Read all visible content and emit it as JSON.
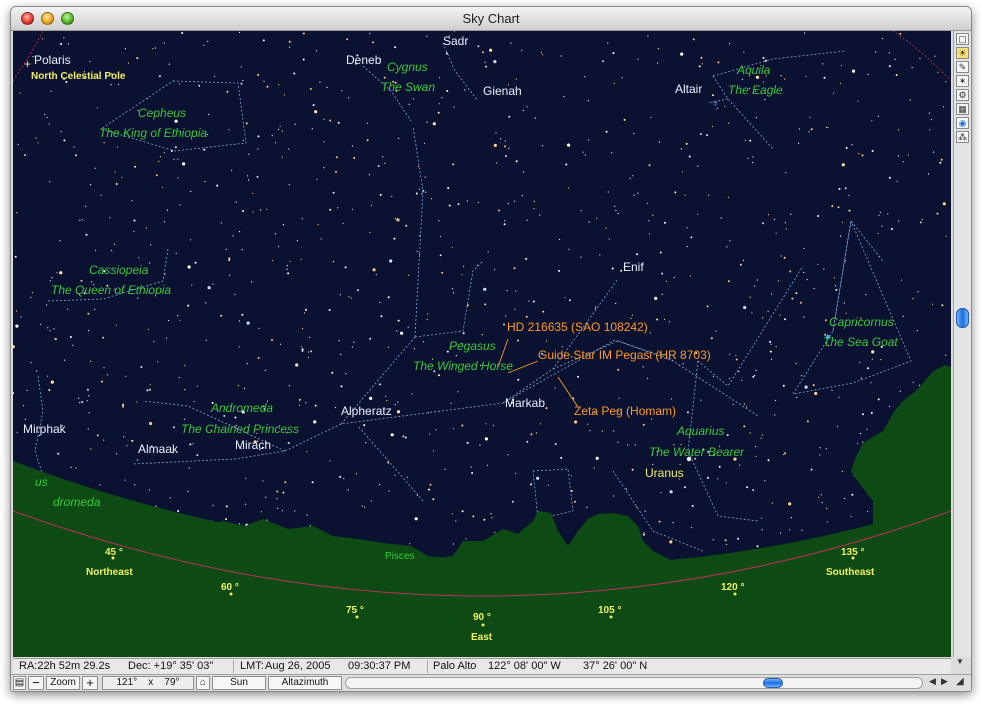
{
  "window": {
    "title": "Sky Chart"
  },
  "sky": {
    "star_labels": [
      {
        "text": "Polaris"
      },
      {
        "text": "North Celestial Pole"
      },
      {
        "text": "Deneb"
      },
      {
        "text": "Sadr"
      },
      {
        "text": "Gienah"
      },
      {
        "text": "Altair"
      },
      {
        "text": "Enif"
      },
      {
        "text": "Markab"
      },
      {
        "text": "Alpheratz"
      },
      {
        "text": "Mirphak"
      },
      {
        "text": "Almaak"
      },
      {
        "text": "Mirach"
      }
    ],
    "constellations": [
      {
        "name": "Cygnus",
        "desc": "The Swan"
      },
      {
        "name": "Cepheus",
        "desc": "The King of Ethiopia"
      },
      {
        "name": "Aquila",
        "desc": "The Eagle"
      },
      {
        "name": "Cassiopeia",
        "desc": "The Queen of Ethiopia"
      },
      {
        "name": "Capricornus",
        "desc": "The Sea Goat"
      },
      {
        "name": "Pegasus",
        "desc": "The Winged Horse"
      },
      {
        "name": "Andromeda",
        "desc": "The Chained Princess"
      },
      {
        "name": "Aquarius",
        "desc": "The Water Bearer"
      }
    ],
    "partial_labels": [
      "us",
      "dromeda",
      "Pisces"
    ],
    "target_labels": [
      "HD 216635  (SAO 108242)",
      "Guide Star IM Pegasi  (HR  8703)",
      "Zeta Peg  (Homam)"
    ],
    "planet": "Uranus",
    "horizon": {
      "directions": [
        "Northeast",
        "East",
        "Southeast"
      ],
      "degrees": [
        "45 °",
        "60 °",
        "75 °",
        "90 °",
        "105 °",
        "120 °",
        "135 °"
      ]
    }
  },
  "status": {
    "ra": "RA:22h 52m 29.2s",
    "dec": "Dec: +19° 35' 03\"",
    "lmt_label": "LMT:",
    "date": "Aug 26, 2005",
    "time": "09:30:37 PM",
    "place": "Palo Alto",
    "lon": "122° 08' 00\" W",
    "lat": "37° 26' 00\" N"
  },
  "toolbar": {
    "zoom_label": "Zoom",
    "zoom_out": "−",
    "zoom_in": "+",
    "fov_w": "121°",
    "fov_x": "x",
    "fov_h": "79°",
    "center_object": "Sun",
    "projection": "Altazimuth"
  },
  "icons": {
    "close": "close-button-icon",
    "minimize": "minimize-button-icon",
    "zoom": "zoom-button-icon",
    "lock": "lock-icon",
    "tool_palette": [
      "window-icon",
      "sun-icon",
      "pencil-icon",
      "star-icon",
      "settings-icon",
      "grid-icon",
      "globe-icon",
      "symbols-icon"
    ]
  },
  "colors": {
    "sky": "#0b1130",
    "ground": "#0d4a14",
    "constellation_label": "#38c83a",
    "star_label": "#e8f0ff",
    "target_label": "#ff9a22",
    "horizon_label": "#f0f060",
    "horizon_line": "#c0305a",
    "selection": "#1f6fe0"
  },
  "scroll": {
    "horizontal_fraction": 0.74,
    "vertical_fraction": 0.45
  }
}
